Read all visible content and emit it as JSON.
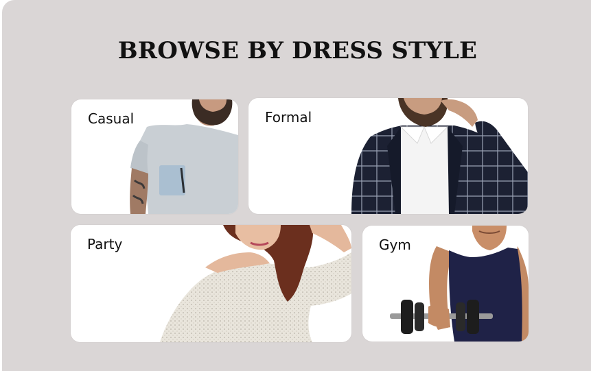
{
  "section": {
    "title": "BROWSE BY DRESS STYLE"
  },
  "styles": [
    {
      "label": "Casual",
      "image": "man-in-grey-tshirt-photo"
    },
    {
      "label": "Formal",
      "image": "man-in-checked-blazer-photo"
    },
    {
      "label": "Party",
      "image": "woman-in-knit-sweater-photo"
    },
    {
      "label": "Gym",
      "image": "man-with-dumbbell-photo"
    }
  ],
  "colors": {
    "background": "#dad6d6",
    "card": "#ffffff",
    "text": "#111111"
  }
}
